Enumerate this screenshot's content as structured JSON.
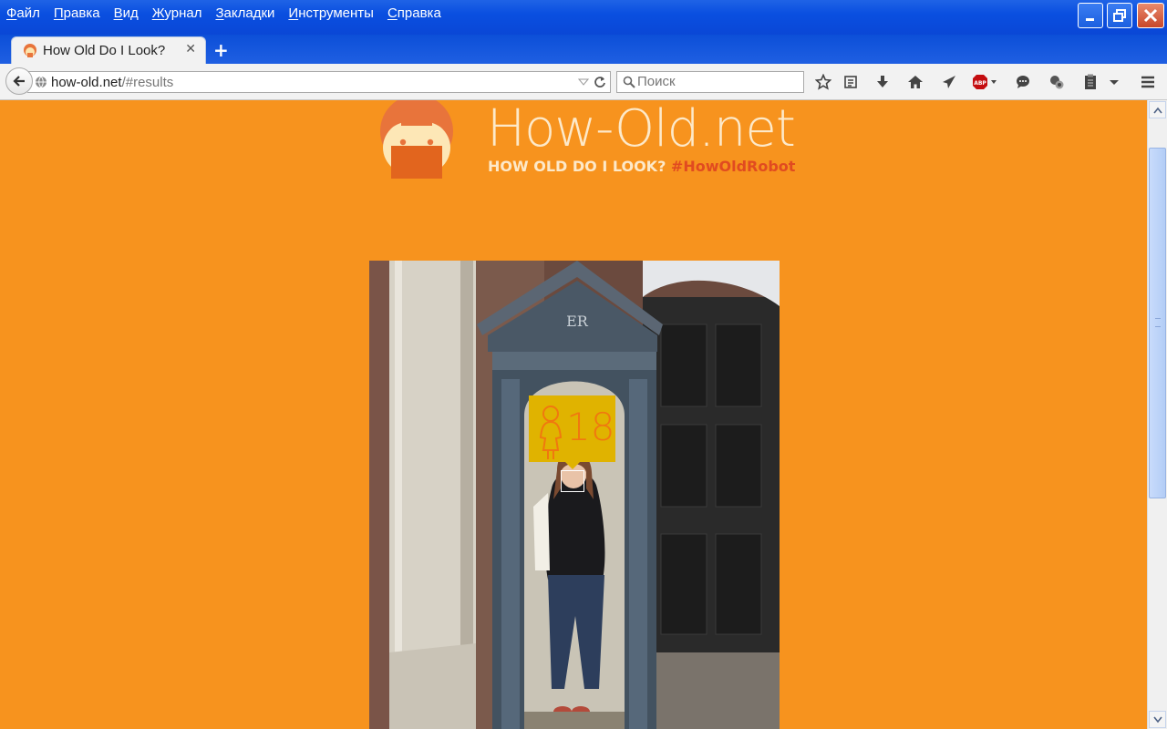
{
  "window": {
    "menu": [
      "Файл",
      "Правка",
      "Вид",
      "Журнал",
      "Закладки",
      "Инструменты",
      "Справка"
    ]
  },
  "tab": {
    "title": "How Old Do I Look?",
    "close": "✕"
  },
  "new_tab": "+",
  "navbar": {
    "url_domain": "how-old.net",
    "url_path": "/#results",
    "search_placeholder": "Поиск"
  },
  "page": {
    "site_title": "How-Old.net",
    "tagline": "HOW OLD DO I LOOK?",
    "hashtag": "#HowOldRobot",
    "result": {
      "gender": "female",
      "age": "18"
    }
  },
  "colors": {
    "background": "#f7931e",
    "badge": "#e0b300",
    "accent": "#e14b20"
  },
  "icons": {
    "toolbar": [
      "star-icon",
      "reading-list-icon",
      "download-icon",
      "home-icon",
      "send-icon",
      "adblock-icon",
      "chat-icon",
      "extension-icon",
      "clipboard-icon",
      "overflow-chevron-icon",
      "hamburger-menu-icon"
    ]
  }
}
